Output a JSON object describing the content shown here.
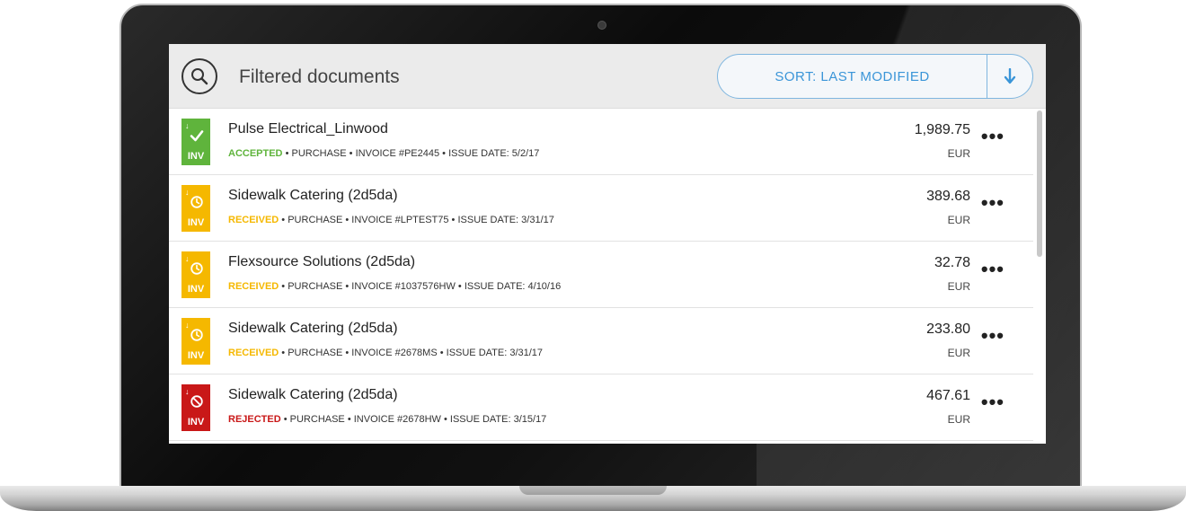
{
  "header": {
    "title": "Filtered documents",
    "sort_label": "SORT: LAST MODIFIED",
    "search_icon": "search-icon",
    "sort_direction_icon": "arrow-down-icon"
  },
  "colors": {
    "accepted": "#5fb43c",
    "received": "#f5b800",
    "rejected": "#c91818",
    "accent": "#3a95d8"
  },
  "documents": [
    {
      "name": "Pulse Electrical_Linwood",
      "status": "ACCEPTED",
      "status_color": "#5fb43c",
      "details": " • PURCHASE • INVOICE #PE2445 • ISSUE DATE: 5/2/17",
      "badge": "INV",
      "icon": "check-icon",
      "amount": "1,989.75",
      "currency": "EUR"
    },
    {
      "name": "Sidewalk Catering (2d5da)",
      "status": "RECEIVED",
      "status_color": "#f5b800",
      "details": " • PURCHASE • INVOICE #LPTEST75 • ISSUE DATE: 3/31/17",
      "badge": "INV",
      "icon": "clock-icon",
      "amount": "389.68",
      "currency": "EUR"
    },
    {
      "name": "Flexsource Solutions (2d5da)",
      "status": "RECEIVED",
      "status_color": "#f5b800",
      "details": " • PURCHASE • INVOICE #1037576HW • ISSUE DATE: 4/10/16",
      "badge": "INV",
      "icon": "clock-icon",
      "amount": "32.78",
      "currency": "EUR"
    },
    {
      "name": "Sidewalk Catering (2d5da)",
      "status": "RECEIVED",
      "status_color": "#f5b800",
      "details": " • PURCHASE • INVOICE #2678MS • ISSUE DATE: 3/31/17",
      "badge": "INV",
      "icon": "clock-icon",
      "amount": "233.80",
      "currency": "EUR"
    },
    {
      "name": "Sidewalk Catering (2d5da)",
      "status": "REJECTED",
      "status_color": "#c91818",
      "details": " • PURCHASE • INVOICE #2678HW • ISSUE DATE: 3/15/17",
      "badge": "INV",
      "icon": "blocked-icon",
      "amount": "467.61",
      "currency": "EUR"
    }
  ]
}
